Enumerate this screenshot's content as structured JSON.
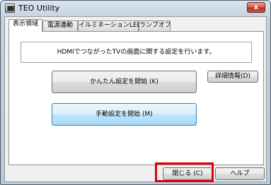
{
  "window": {
    "title": "TEO Utility",
    "close_glyph": "x"
  },
  "tabs": [
    {
      "label": "表示領域",
      "active": true
    },
    {
      "label": "電源連動",
      "active": false
    },
    {
      "label": "イルミネーションLED",
      "active": false
    },
    {
      "label": "ランプオフ",
      "active": false
    }
  ],
  "panel": {
    "message": "HDMIでつながったTVの画面に関する設定を行います。",
    "easy_setup_label": "かんたん設定を開始 (K)",
    "manual_setup_label": "手動設定を開始 (M)",
    "details_label": "詳細情報(D)"
  },
  "footer": {
    "close_label": "閉じる (C)",
    "help_label": "ヘルプ"
  },
  "colors": {
    "highlight": "#e0000e",
    "close_button": "#c9533f"
  },
  "icons": {
    "app": "app-icon",
    "close": "close-icon"
  }
}
